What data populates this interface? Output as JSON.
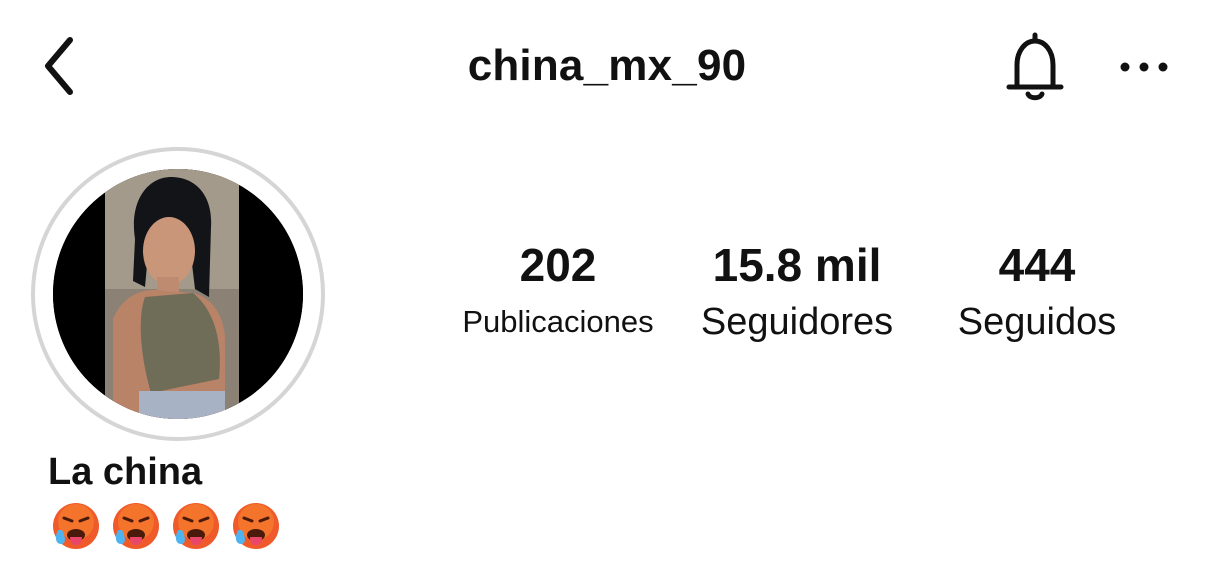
{
  "header": {
    "username": "china_mx_90",
    "icons": {
      "back": "chevron-left-icon",
      "notifications": "bell-icon",
      "more": "more-horizontal-icon"
    }
  },
  "profile": {
    "display_name": "La china",
    "bio_emojis": [
      "🥵",
      "🥵",
      "🥵",
      "🥵"
    ],
    "story_ring_color": "#d5d5d5"
  },
  "stats": {
    "posts": {
      "value": "202",
      "label": "Publicaciones"
    },
    "followers": {
      "value": "15.8 mil",
      "label": "Seguidores"
    },
    "following": {
      "value": "444",
      "label": "Seguidos"
    }
  }
}
